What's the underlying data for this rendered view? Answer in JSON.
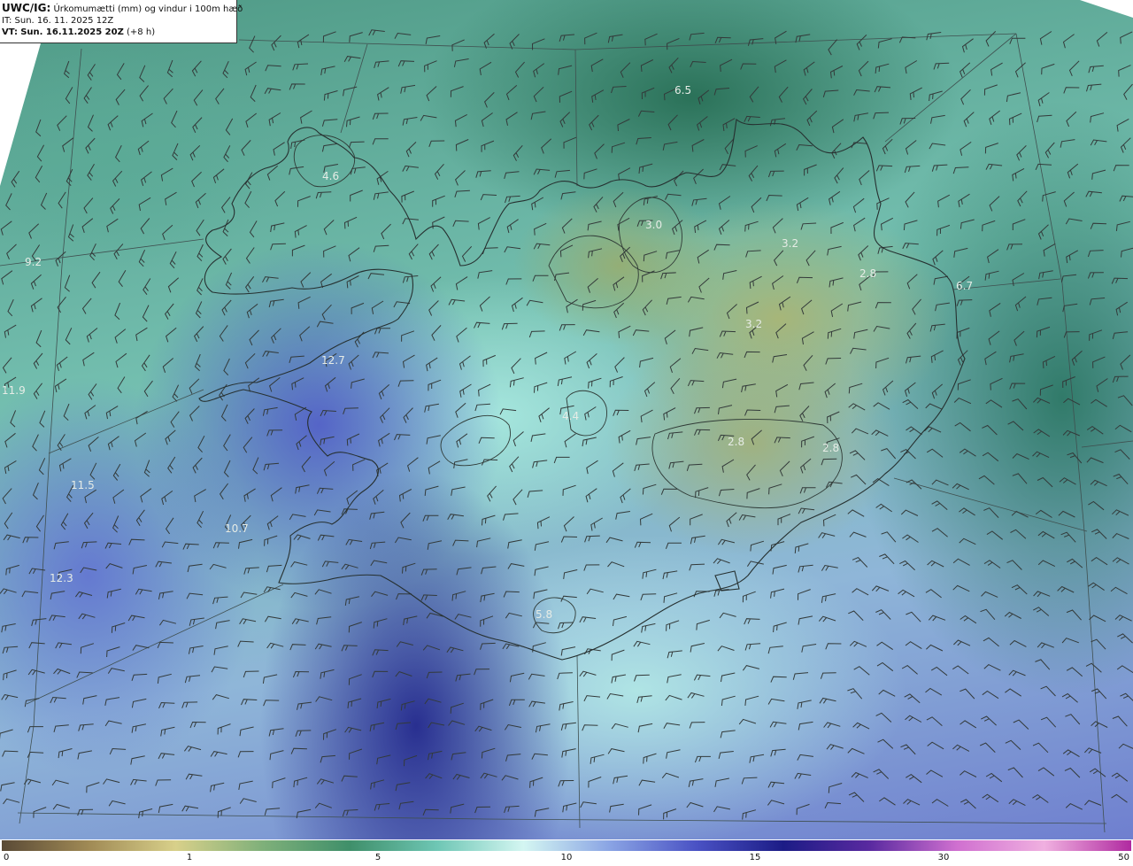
{
  "header": {
    "title_prefix": "UWC/IG:",
    "title": "Úrkomumætti (mm) og vindur i 100m hæð",
    "init_prefix": "IT:",
    "init_time": "Sun. 16. 11. 2025 12Z",
    "valid_prefix": "VT:",
    "valid_time": "Sun. 16.11.2025 20Z",
    "lead_time": "(+8 h)"
  },
  "map": {
    "field_colors": {
      "dry": "#8a7a4a",
      "low": "#c8c078",
      "mid_green": "#3f8f6a",
      "cyan": "#bff0ec",
      "blue": "#6070d0",
      "deep_blue": "#20208a",
      "violet": "#a030a0"
    },
    "value_labels": [
      {
        "text": "6.5"
      },
      {
        "text": "4.6"
      },
      {
        "text": "3.0"
      },
      {
        "text": "3.2"
      },
      {
        "text": "2.8"
      },
      {
        "text": "6.7"
      },
      {
        "text": "3.2"
      },
      {
        "text": "12.7"
      },
      {
        "text": "4.4"
      },
      {
        "text": "2.8"
      },
      {
        "text": "2.8"
      },
      {
        "text": "11.9"
      },
      {
        "text": "11.5"
      },
      {
        "text": "10.7"
      },
      {
        "text": "12.3"
      },
      {
        "text": "5.8"
      },
      {
        "text": "9.2"
      }
    ]
  },
  "colorbar": {
    "ticks": [
      "0",
      "1",
      "5",
      "10",
      "15",
      "30",
      "50"
    ],
    "colors": [
      "#5a4a36",
      "#a08a55",
      "#d8d08a",
      "#7fb07a",
      "#3f8f6a",
      "#6ec6b4",
      "#d4f6f2",
      "#8aa4e4",
      "#4a52c4",
      "#1c1c86",
      "#5a2aa0",
      "#d070d0",
      "#f0b0e0",
      "#b02aa0"
    ]
  }
}
